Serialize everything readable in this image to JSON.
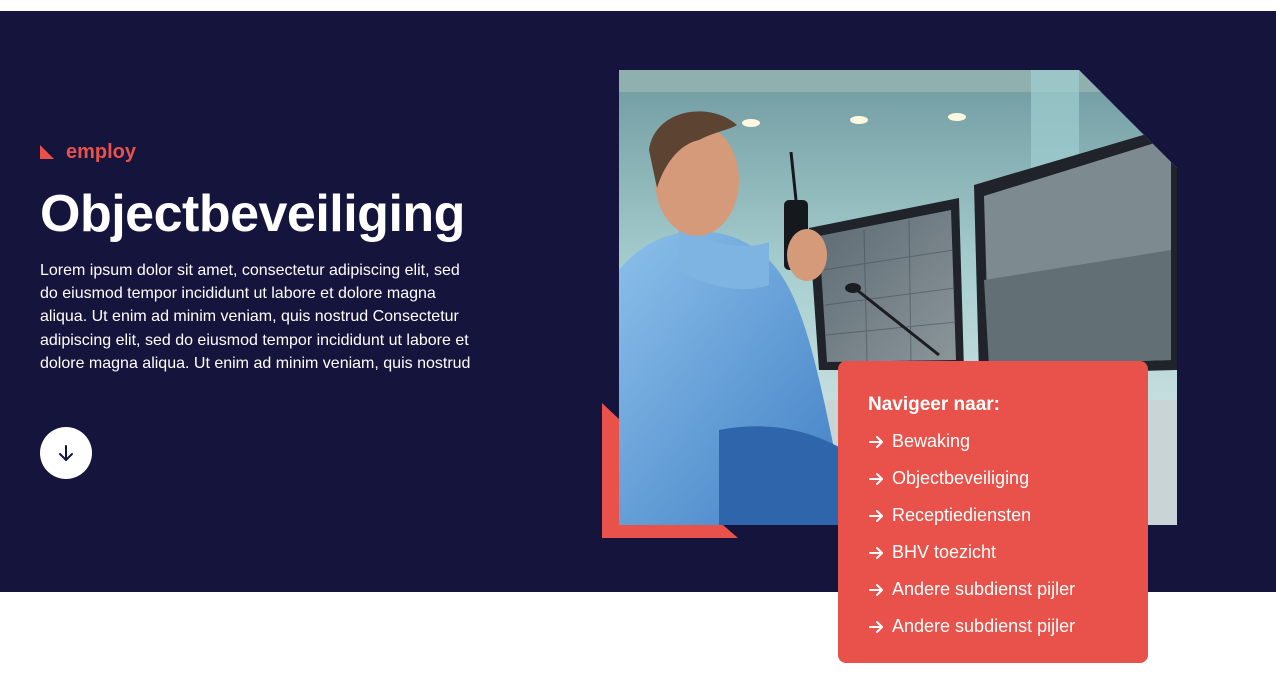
{
  "brand": {
    "name": "employ",
    "accent_color": "#e8524a"
  },
  "hero": {
    "background_color": "#14143d",
    "title": "Objectbeveiliging",
    "description": "Lorem ipsum dolor sit amet, consectetur adipiscing elit, sed do eiusmod tempor incididunt ut labore et dolore magna aliqua. Ut enim ad minim veniam, quis nostrud Consectetur adipiscing elit, sed do eiusmod tempor incididunt ut labore et dolore magna aliqua. Ut enim ad minim veniam, quis nostrud",
    "scroll_button_icon": "arrow-down-icon",
    "image_subject": "security-officer-monitoring-cctv-screens"
  },
  "navigation_card": {
    "heading": "Navigeer naar:",
    "item_icon": "arrow-right-icon",
    "items": [
      {
        "label": "Bewaking"
      },
      {
        "label": "Objectbeveiliging"
      },
      {
        "label": "Receptiediensten"
      },
      {
        "label": "BHV toezicht"
      },
      {
        "label": "Andere subdienst pijler"
      },
      {
        "label": "Andere subdienst pijler"
      }
    ]
  }
}
